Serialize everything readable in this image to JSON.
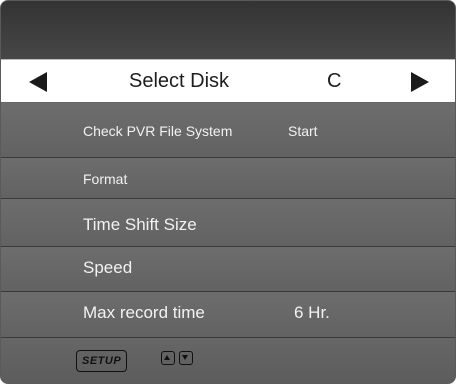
{
  "select_disk": {
    "label": "Select Disk",
    "value": "C",
    "left_arrow_icon": "left-arrow-icon",
    "right_arrow_icon": "right-arrow-icon"
  },
  "menu": {
    "items": [
      {
        "label": "Check PVR File System",
        "value": "Start"
      },
      {
        "label": "Format",
        "value": ""
      },
      {
        "label": "Time Shift Size",
        "value": ""
      },
      {
        "label": "Speed",
        "value": ""
      },
      {
        "label": "Max record time",
        "value": "6 Hr."
      }
    ]
  },
  "footer": {
    "setup_key": "SETUP",
    "up_icon": "up-arrow-icon",
    "down_icon": "down-arrow-icon"
  }
}
